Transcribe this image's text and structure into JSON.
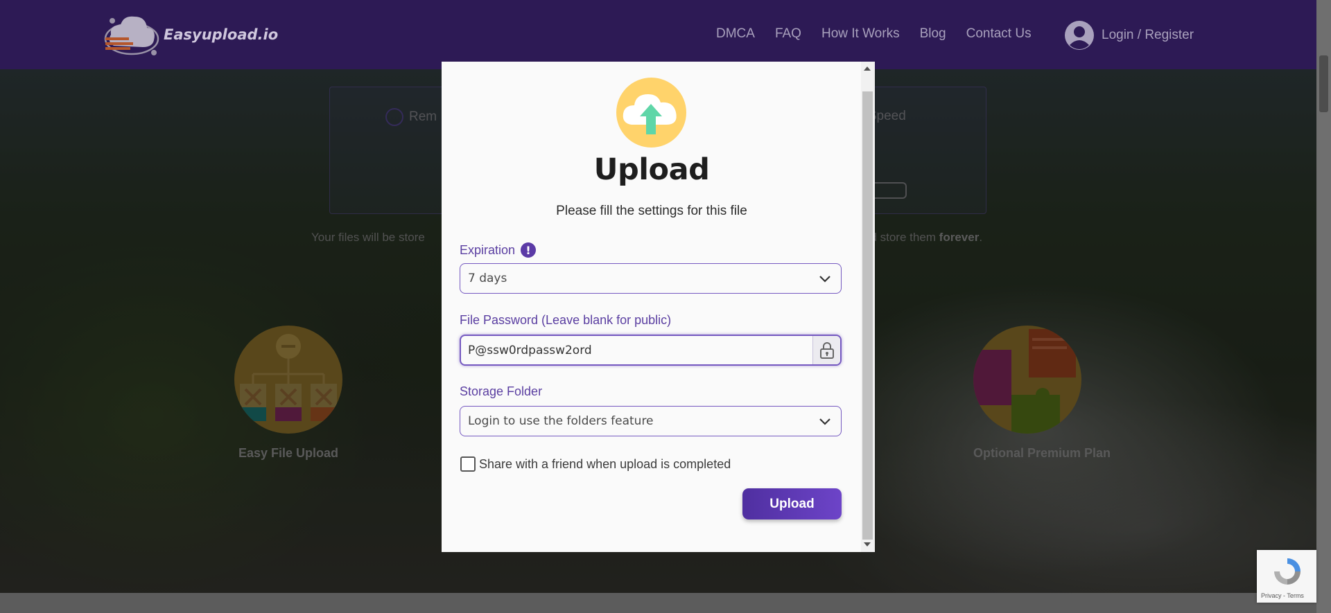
{
  "navbar": {
    "brand": "Easyupload.io",
    "links": [
      "DMCA",
      "FAQ",
      "How It Works",
      "Blog",
      "Contact Us"
    ],
    "login_label": "Login / Register"
  },
  "background": {
    "info_left": "Rem",
    "info_right": "d Speed",
    "storage_left": "Your files will be store",
    "storage_right_prefix": "nd store them ",
    "storage_right_bold": "forever",
    "storage_right_suffix": ".",
    "feature_left": "Easy File Upload",
    "feature_right": "Optional Premium Plan"
  },
  "modal": {
    "title": "Upload",
    "subtitle": "Please fill the settings for this file",
    "expiration": {
      "label": "Expiration",
      "info_glyph": "!",
      "selected": "7 days"
    },
    "password": {
      "label": "File Password (Leave blank for public)",
      "value": "P@ssw0rdpassw2ord"
    },
    "folder": {
      "label": "Storage Folder",
      "selected": "Login to use the folders feature"
    },
    "share_label": "Share with a friend when upload is completed",
    "upload_button": "Upload"
  },
  "recaptcha": {
    "footer": "Privacy - Terms"
  },
  "colors": {
    "navbar": "#2d1a55",
    "accent": "#5b3aa6",
    "button": "#5a37b0",
    "cloud_bg": "#ffd36b"
  },
  "icons": [
    "brand-logo-icon",
    "user-avatar-icon",
    "cloud-upload-icon",
    "info-icon",
    "chevron-down-icon",
    "lock-icon",
    "recaptcha-icon"
  ]
}
